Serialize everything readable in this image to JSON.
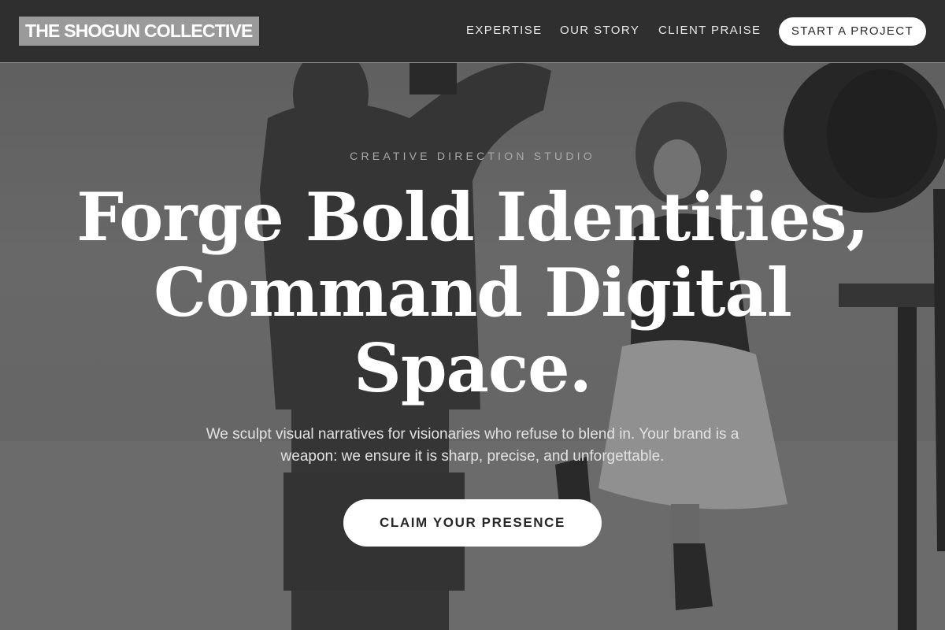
{
  "header": {
    "logo": "THE SHOGUN COLLECTIVE",
    "nav": [
      {
        "label": "EXPERTISE"
      },
      {
        "label": "OUR STORY"
      },
      {
        "label": "CLIENT PRAISE"
      }
    ],
    "cta_label": "START A PROJECT"
  },
  "hero": {
    "eyebrow": "CREATIVE DIRECTION STUDIO",
    "headline_lines": [
      "Forge Bold Identities,",
      "Command Digital",
      "Space."
    ],
    "subtext": "We sculpt visual narratives for visionaries who refuse to blend in. Your brand is a weapon: we ensure it is sharp, precise, and unforgettable.",
    "cta_label": "CLAIM YOUR PRESENCE"
  },
  "colors": {
    "header_bg": "#2f2f2f",
    "logo_bg": "#9a9a9a",
    "button_bg": "#ffffff",
    "button_text": "#262626"
  }
}
